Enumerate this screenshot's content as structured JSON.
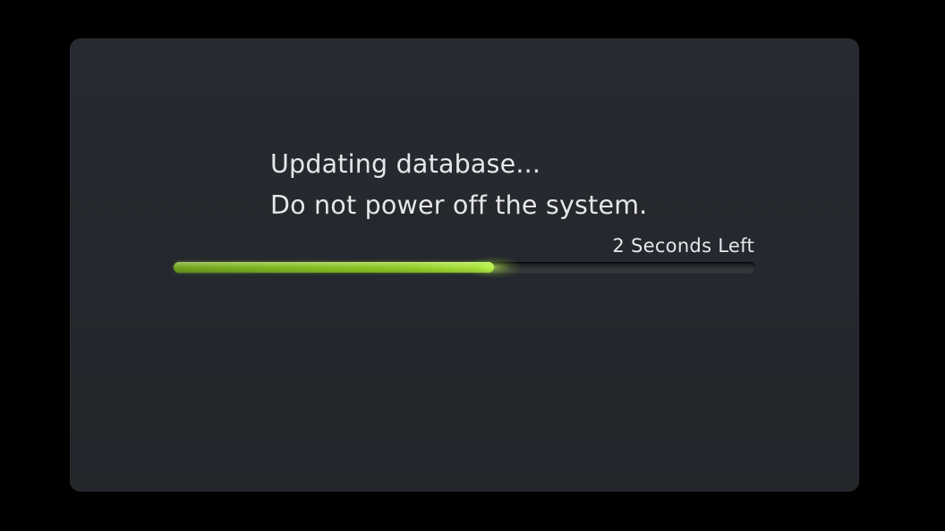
{
  "dialog": {
    "message_line1": "Updating database...",
    "message_line2": "Do not power off the system.",
    "time_left": "2 Seconds Left",
    "progress_fraction": 0.55
  },
  "colors": {
    "background": "#000000",
    "dialog_bg": "#25282e",
    "text": "#e6e7e9",
    "progress_fill": "#8fcb22",
    "progress_track": "#2e3136"
  }
}
